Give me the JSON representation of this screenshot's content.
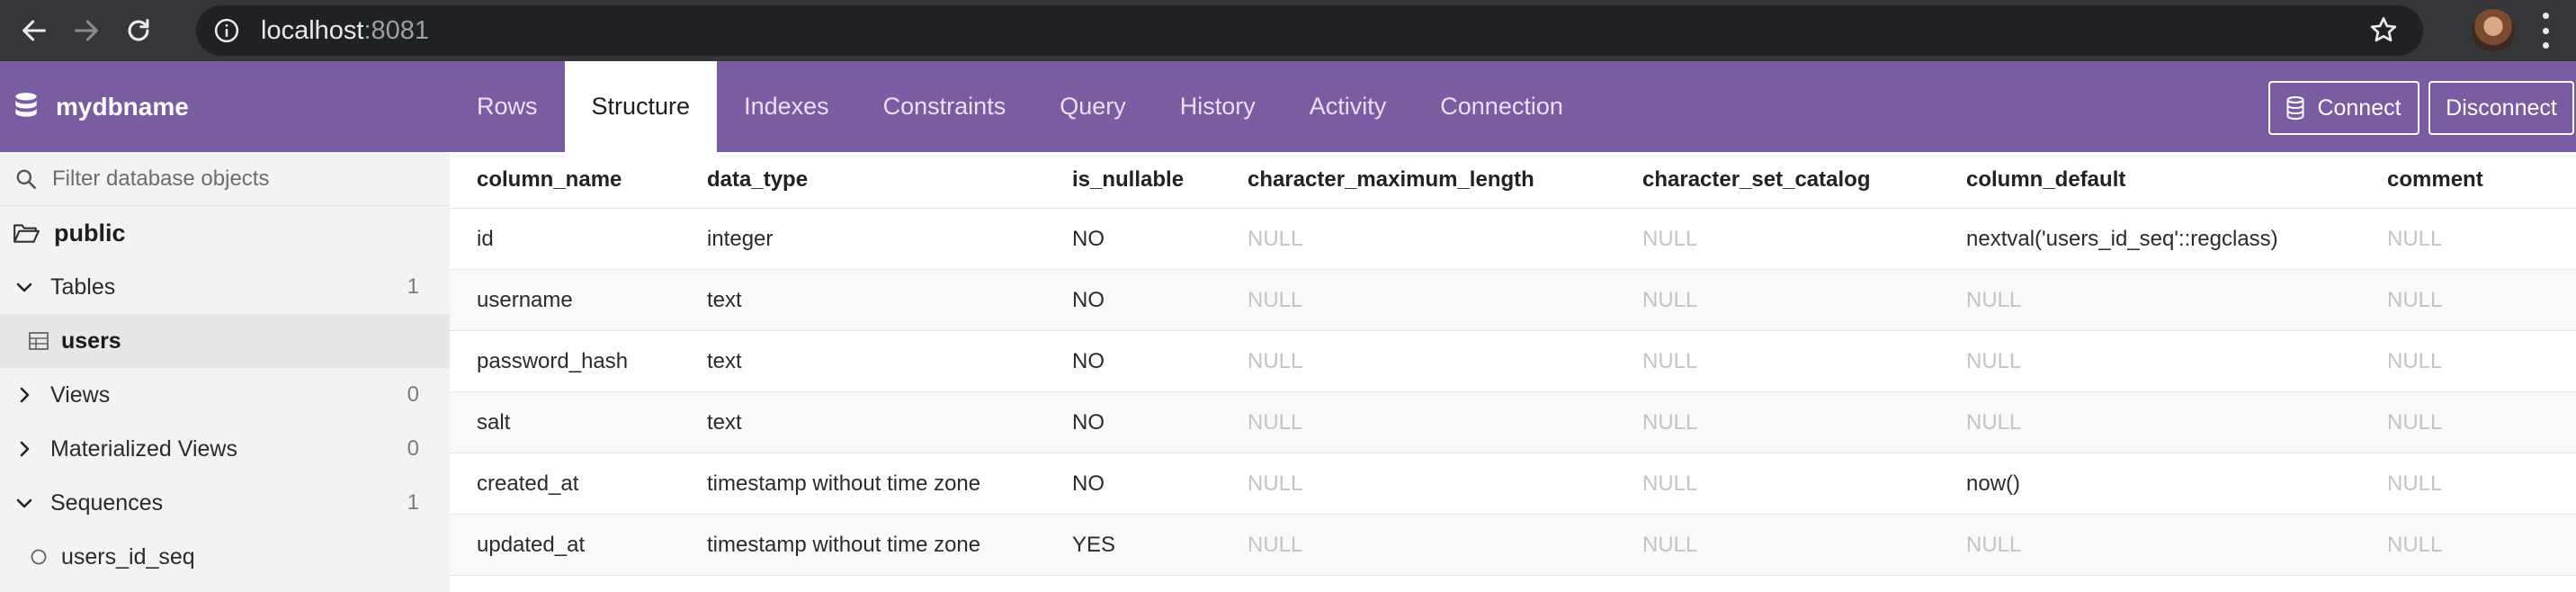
{
  "browser": {
    "url_host": "localhost",
    "url_port": ":8081"
  },
  "app": {
    "db_name": "mydbname",
    "tabs": [
      {
        "label": "Rows",
        "active": false
      },
      {
        "label": "Structure",
        "active": true
      },
      {
        "label": "Indexes",
        "active": false
      },
      {
        "label": "Constraints",
        "active": false
      },
      {
        "label": "Query",
        "active": false
      },
      {
        "label": "History",
        "active": false
      },
      {
        "label": "Activity",
        "active": false
      },
      {
        "label": "Connection",
        "active": false
      }
    ],
    "connect_label": "Connect",
    "disconnect_label": "Disconnect",
    "accent_color": "#7a5ca2"
  },
  "sidebar": {
    "filter_placeholder": "Filter database objects",
    "schema": "public",
    "groups": [
      {
        "label": "Tables",
        "count": "1",
        "expanded": true,
        "items": [
          "users"
        ]
      },
      {
        "label": "Views",
        "count": "0",
        "expanded": false,
        "items": []
      },
      {
        "label": "Materialized Views",
        "count": "0",
        "expanded": false,
        "items": []
      },
      {
        "label": "Sequences",
        "count": "1",
        "expanded": true,
        "items": [
          "users_id_seq"
        ]
      }
    ],
    "selected_item": "users"
  },
  "table": {
    "columns": [
      "column_name",
      "data_type",
      "is_nullable",
      "character_maximum_length",
      "character_set_catalog",
      "column_default",
      "comment"
    ],
    "rows": [
      [
        "id",
        "integer",
        "NO",
        "NULL",
        "NULL",
        "nextval('users_id_seq'::regclass)",
        "NULL"
      ],
      [
        "username",
        "text",
        "NO",
        "NULL",
        "NULL",
        "NULL",
        "NULL"
      ],
      [
        "password_hash",
        "text",
        "NO",
        "NULL",
        "NULL",
        "NULL",
        "NULL"
      ],
      [
        "salt",
        "text",
        "NO",
        "NULL",
        "NULL",
        "NULL",
        "NULL"
      ],
      [
        "created_at",
        "timestamp without time zone",
        "NO",
        "NULL",
        "NULL",
        "now()",
        "NULL"
      ],
      [
        "updated_at",
        "timestamp without time zone",
        "YES",
        "NULL",
        "NULL",
        "NULL",
        "NULL"
      ]
    ]
  }
}
